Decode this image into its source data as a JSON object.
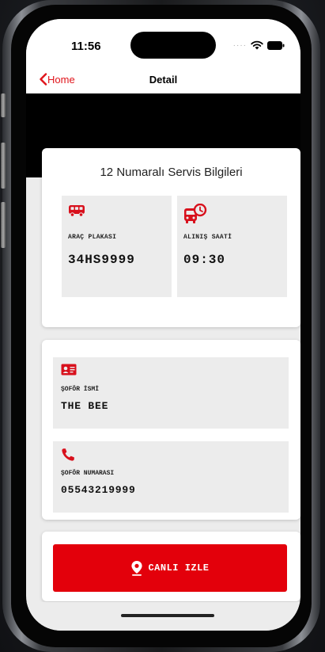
{
  "status_bar": {
    "time": "11:56"
  },
  "nav": {
    "back_label": "Home",
    "title": "Detail"
  },
  "info_card": {
    "title": "12 Numaralı Servis Bilgileri",
    "tiles": [
      {
        "icon": "bus-icon",
        "label": "ARAÇ PLAKASI",
        "value": "34HS9999"
      },
      {
        "icon": "bus-clock-icon",
        "label": "ALINIŞ SAATİ",
        "value": "09:30"
      }
    ]
  },
  "driver_card": {
    "name_label": "ŞOFÖR İSMİ",
    "name_value": "THE BEE",
    "name_icon": "id-card-icon",
    "phone_label": "ŞOFÖR NUMARASI",
    "phone_value": "05543219999",
    "phone_icon": "phone-icon"
  },
  "action": {
    "live_button_label": "CANLI IZLE",
    "icon": "location-pin-icon"
  },
  "colors": {
    "accent": "#e3000b",
    "tile_bg": "#ececec"
  }
}
